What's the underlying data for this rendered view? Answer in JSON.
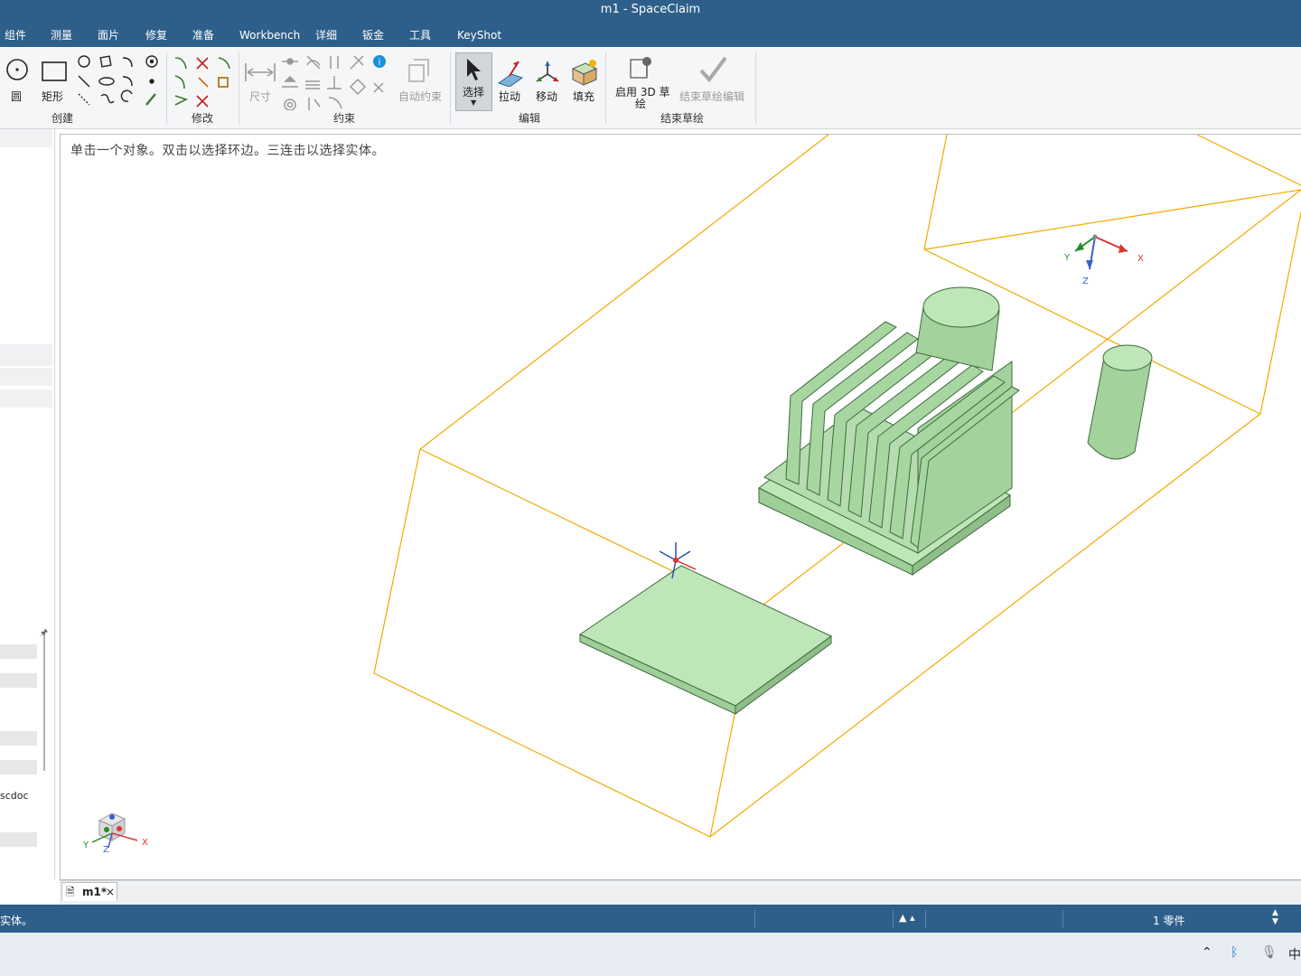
{
  "window": {
    "title": "m1 - SpaceClaim"
  },
  "menu": {
    "items": [
      "组件",
      "测量",
      "面片",
      "修复",
      "准备",
      "Workbench",
      "详细",
      "钣金",
      "工具",
      "KeyShot"
    ]
  },
  "ribbon": {
    "groups": {
      "create": "创建",
      "modify": "修改",
      "constrain": "约束",
      "edit": "编辑",
      "end_sketch": "结束草绘"
    },
    "tools": {
      "circle": "圆",
      "rectangle": "矩形",
      "dimension": "尺寸",
      "auto_constrain": "自动约束",
      "select": "选择",
      "pull": "拉动",
      "move": "移动",
      "fill": "填充",
      "enable_3d_line1": "启用 3D 草",
      "enable_3d_line2": "绘",
      "end_sketch_edit": "结束草绘编辑"
    }
  },
  "left_panel": {
    "file_fragment": "scdoc",
    "pin_icon": "pin-icon"
  },
  "viewport": {
    "hint": "单击一个对象。双击以选择环边。三连击以选择实体。",
    "triad_top": {
      "x": "X",
      "y": "Y",
      "z": "Z"
    },
    "triad_bottom": {
      "x": "X",
      "y": "Y",
      "z": "Z"
    },
    "colors": {
      "solid": "#b9e2b4",
      "edge": "#3c6b3c",
      "enclosure": "#f2a900"
    }
  },
  "tabs": {
    "doc": "m1*",
    "close": "×"
  },
  "status": {
    "message": "实体。",
    "count": "1 零件"
  },
  "taskbar": {
    "ime": "中"
  }
}
